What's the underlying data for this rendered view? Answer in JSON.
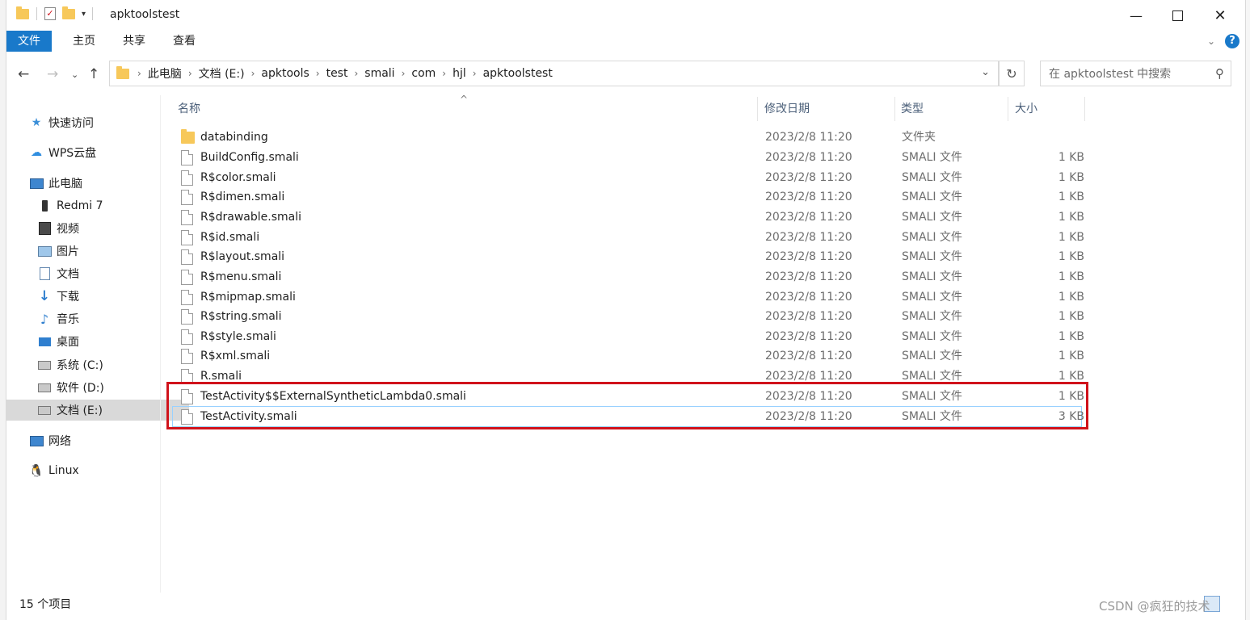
{
  "window": {
    "title": "apktoolstest"
  },
  "ribbon": {
    "tabs": [
      {
        "label": "文件",
        "active": true
      },
      {
        "label": "主页",
        "active": false
      },
      {
        "label": "共享",
        "active": false
      },
      {
        "label": "查看",
        "active": false
      }
    ]
  },
  "address": {
    "crumbs": [
      "此电脑",
      "文档 (E:)",
      "apktools",
      "test",
      "smali",
      "com",
      "hjl",
      "apktoolstest"
    ]
  },
  "search": {
    "placeholder": "在 apktoolstest 中搜索"
  },
  "sidebar": {
    "items": [
      {
        "label": "快速访问",
        "icon": "star-icon"
      },
      {
        "label": "WPS云盘",
        "icon": "cloud-icon"
      },
      {
        "label": "此电脑",
        "icon": "computer-icon"
      },
      {
        "label": "Redmi 7",
        "icon": "phone-icon"
      },
      {
        "label": "视频",
        "icon": "video-icon"
      },
      {
        "label": "图片",
        "icon": "pictures-icon"
      },
      {
        "label": "文档",
        "icon": "documents-icon"
      },
      {
        "label": "下载",
        "icon": "download-icon"
      },
      {
        "label": "音乐",
        "icon": "music-icon"
      },
      {
        "label": "桌面",
        "icon": "desktop-icon"
      },
      {
        "label": "系统 (C:)",
        "icon": "drive-icon"
      },
      {
        "label": "软件 (D:)",
        "icon": "drive-icon"
      },
      {
        "label": "文档 (E:)",
        "icon": "drive-icon",
        "selected": true
      },
      {
        "label": "网络",
        "icon": "network-icon"
      },
      {
        "label": "Linux",
        "icon": "linux-icon"
      }
    ]
  },
  "columns": {
    "name": "名称",
    "date": "修改日期",
    "type": "类型",
    "size": "大小"
  },
  "files": [
    {
      "name": "databinding",
      "date": "2023/2/8 11:20",
      "type": "文件夹",
      "size": "",
      "kind": "folder"
    },
    {
      "name": "BuildConfig.smali",
      "date": "2023/2/8 11:20",
      "type": "SMALI 文件",
      "size": "1 KB",
      "kind": "file"
    },
    {
      "name": "R$color.smali",
      "date": "2023/2/8 11:20",
      "type": "SMALI 文件",
      "size": "1 KB",
      "kind": "file"
    },
    {
      "name": "R$dimen.smali",
      "date": "2023/2/8 11:20",
      "type": "SMALI 文件",
      "size": "1 KB",
      "kind": "file"
    },
    {
      "name": "R$drawable.smali",
      "date": "2023/2/8 11:20",
      "type": "SMALI 文件",
      "size": "1 KB",
      "kind": "file"
    },
    {
      "name": "R$id.smali",
      "date": "2023/2/8 11:20",
      "type": "SMALI 文件",
      "size": "1 KB",
      "kind": "file"
    },
    {
      "name": "R$layout.smali",
      "date": "2023/2/8 11:20",
      "type": "SMALI 文件",
      "size": "1 KB",
      "kind": "file"
    },
    {
      "name": "R$menu.smali",
      "date": "2023/2/8 11:20",
      "type": "SMALI 文件",
      "size": "1 KB",
      "kind": "file"
    },
    {
      "name": "R$mipmap.smali",
      "date": "2023/2/8 11:20",
      "type": "SMALI 文件",
      "size": "1 KB",
      "kind": "file"
    },
    {
      "name": "R$string.smali",
      "date": "2023/2/8 11:20",
      "type": "SMALI 文件",
      "size": "1 KB",
      "kind": "file"
    },
    {
      "name": "R$style.smali",
      "date": "2023/2/8 11:20",
      "type": "SMALI 文件",
      "size": "1 KB",
      "kind": "file"
    },
    {
      "name": "R$xml.smali",
      "date": "2023/2/8 11:20",
      "type": "SMALI 文件",
      "size": "1 KB",
      "kind": "file"
    },
    {
      "name": "R.smali",
      "date": "2023/2/8 11:20",
      "type": "SMALI 文件",
      "size": "1 KB",
      "kind": "file"
    },
    {
      "name": "TestActivity$$ExternalSyntheticLambda0.smali",
      "date": "2023/2/8 11:20",
      "type": "SMALI 文件",
      "size": "1 KB",
      "kind": "file"
    },
    {
      "name": "TestActivity.smali",
      "date": "2023/2/8 11:20",
      "type": "SMALI 文件",
      "size": "3 KB",
      "kind": "file",
      "focused": true
    }
  ],
  "status": {
    "count": "15 个项目"
  },
  "watermark": "CSDN @疯狂的技术",
  "colors": {
    "accent": "#1979ca",
    "highlight": "#d0121b",
    "folder": "#f7c85a"
  }
}
